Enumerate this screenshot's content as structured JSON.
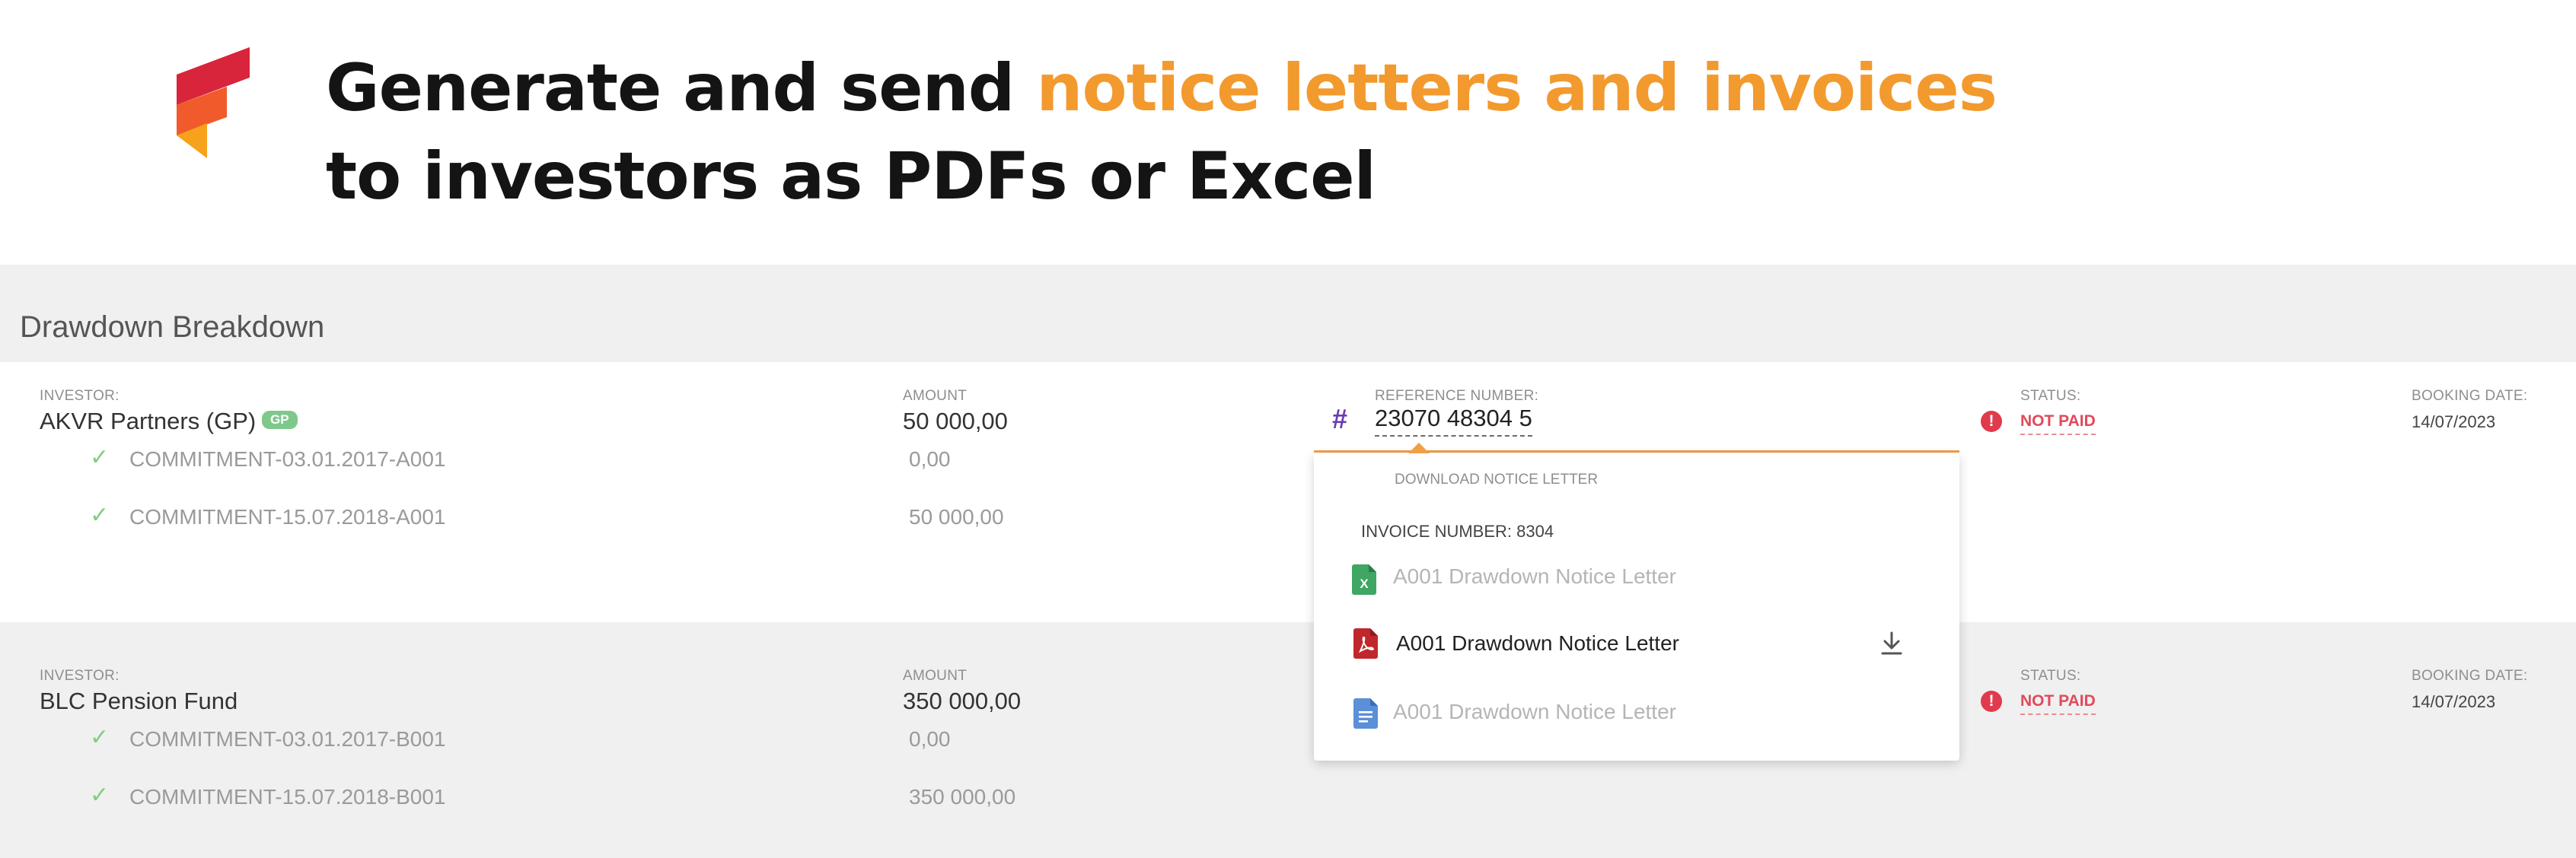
{
  "hero": {
    "line1_prefix": "Generate and send ",
    "line1_accent": "notice letters and invoices",
    "line2": "to investors as PDFs or Excel"
  },
  "colors": {
    "accent": "#f29a2e",
    "logo_red": "#d9253b",
    "logo_orange": "#f15a2b",
    "logo_yellow": "#f7a21b",
    "panel_bg": "#f0f0f0",
    "status_not_paid": "#e14a5a",
    "check": "#7fcf7f",
    "hash": "#6a3cb0",
    "focus_underline": "#f0a046"
  },
  "section": {
    "title": "Drawdown Breakdown"
  },
  "labels": {
    "investor": "INVESTOR:",
    "amount": "AMOUNT",
    "reference": "REFERENCE NUMBER:",
    "status": "STATUS:",
    "booking_date": "BOOKING DATE:"
  },
  "rows": [
    {
      "investor": "AKVR Partners (GP)",
      "badge": "GP",
      "amount": "50 000,00",
      "reference": "23070 48304 5",
      "status": "NOT PAID",
      "booking_date": "14/07/2023",
      "commitments": [
        {
          "name": "COMMITMENT-03.01.2017-A001",
          "amount": "0,00"
        },
        {
          "name": "COMMITMENT-15.07.2018-A001",
          "amount": "50 000,00"
        }
      ]
    },
    {
      "investor": "BLC Pension Fund",
      "amount": "350 000,00",
      "status": "NOT PAID",
      "booking_date": "14/07/2023",
      "commitments": [
        {
          "name": "COMMITMENT-03.01.2017-B001",
          "amount": "0,00"
        },
        {
          "name": "COMMITMENT-15.07.2018-B001",
          "amount": "350 000,00"
        }
      ]
    }
  ],
  "dropdown": {
    "header": "DOWNLOAD NOTICE LETTER",
    "invoice_number": "INVOICE NUMBER: 8304",
    "files": [
      {
        "type": "excel",
        "icon": "excel-file-icon",
        "name": "A001 Drawdown Notice Letter",
        "enabled": false
      },
      {
        "type": "pdf",
        "icon": "pdf-file-icon",
        "name": "A001 Drawdown Notice Letter",
        "enabled": true
      },
      {
        "type": "doc",
        "icon": "doc-file-icon",
        "name": "A001 Drawdown Notice Letter",
        "enabled": false
      }
    ],
    "download_icon": "download-icon"
  }
}
